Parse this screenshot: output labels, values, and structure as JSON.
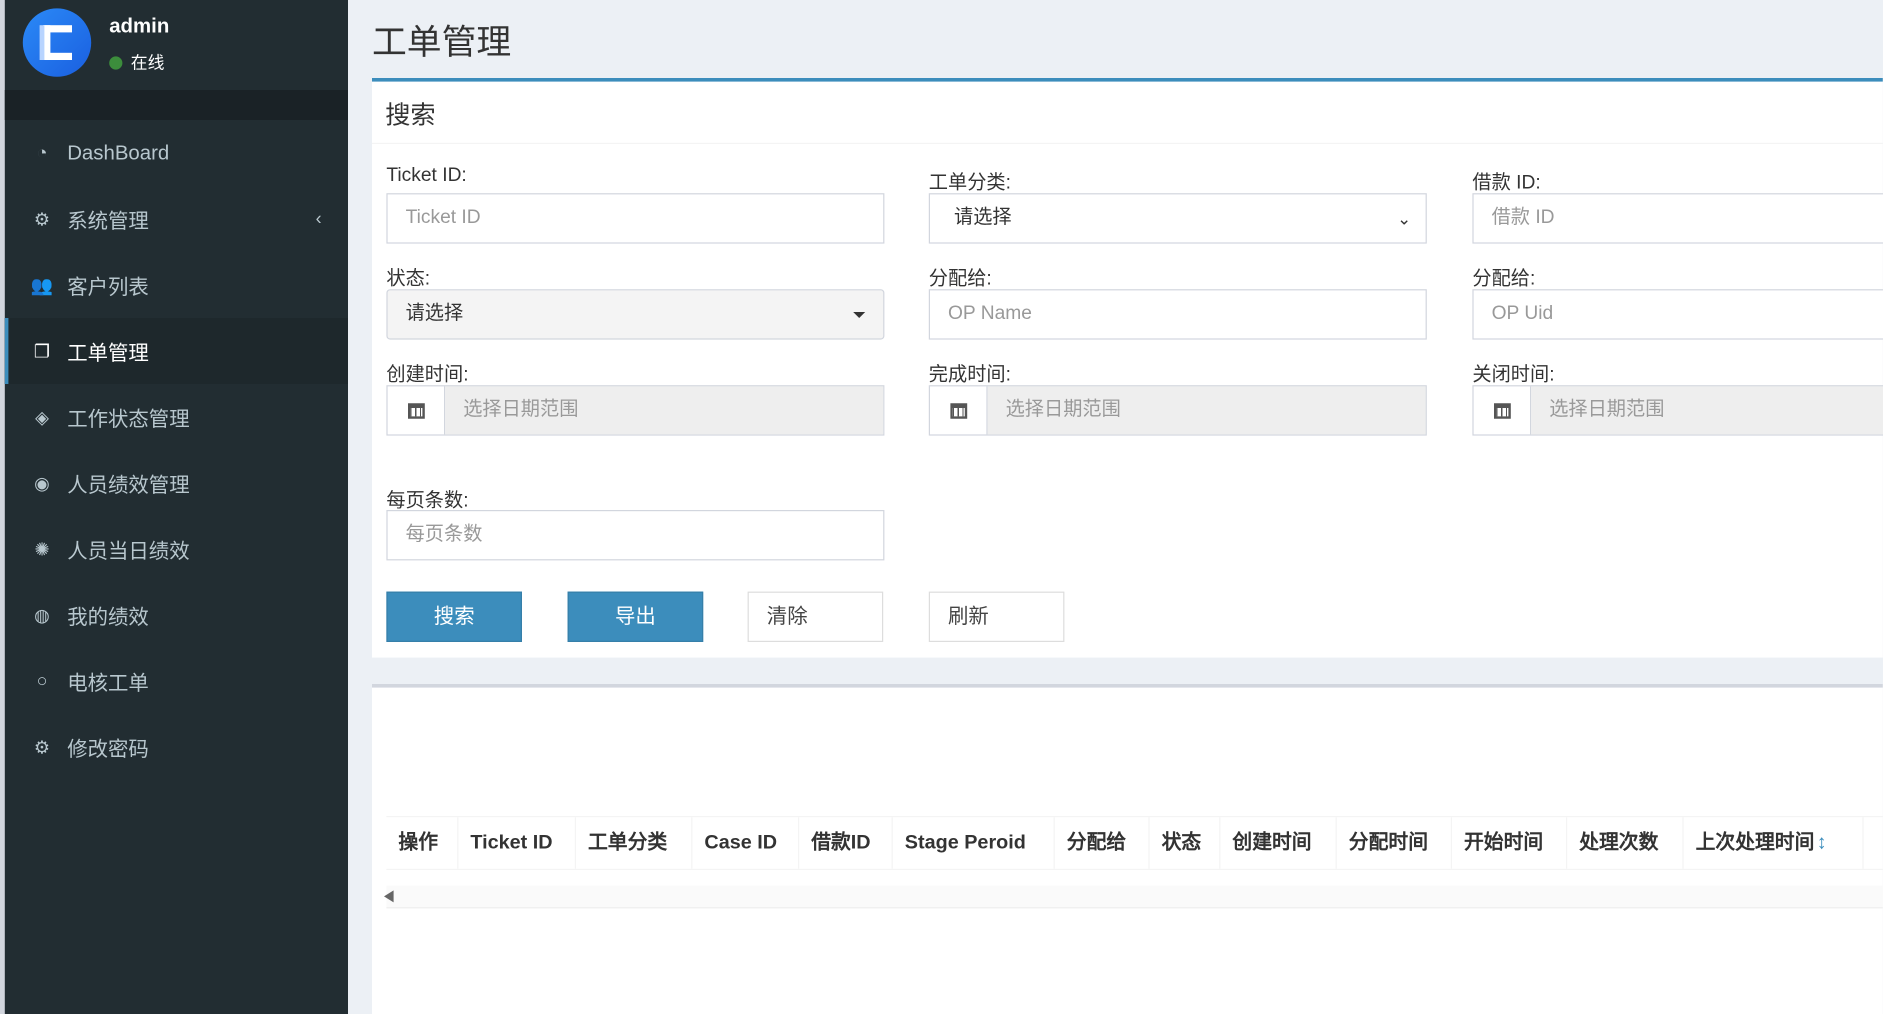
{
  "user": {
    "name": "admin",
    "status": "在线",
    "status_color": "#3c8d3c"
  },
  "sidebar": {
    "items": [
      {
        "label": "DashBoard",
        "icon": "dashboard-icon"
      },
      {
        "label": "系统管理",
        "icon": "cogs-icon",
        "has_submenu": true
      },
      {
        "label": "客户列表",
        "icon": "users-icon"
      },
      {
        "label": "工单管理",
        "icon": "copy-icon",
        "active": true
      },
      {
        "label": "工作状态管理",
        "icon": "tag-icon"
      },
      {
        "label": "人员绩效管理",
        "icon": "performance-icon"
      },
      {
        "label": "人员当日绩效",
        "icon": "daily-performance-icon"
      },
      {
        "label": "我的绩效",
        "icon": "chrome-icon"
      },
      {
        "label": "电核工单",
        "icon": "circle-icon"
      },
      {
        "label": "修改密码",
        "icon": "gear-icon"
      }
    ]
  },
  "page": {
    "title": "工单管理"
  },
  "search": {
    "title": "搜索",
    "ticket_id": {
      "label": "Ticket ID:",
      "placeholder": "Ticket ID"
    },
    "category": {
      "label": "工单分类:",
      "value": "请选择"
    },
    "loan_id": {
      "label": "借款 ID:",
      "placeholder": "借款 ID"
    },
    "status": {
      "label": "状态:",
      "value": "请选择"
    },
    "assign_name": {
      "label": "分配给:",
      "placeholder": "OP Name"
    },
    "assign_uid": {
      "label": "分配给:",
      "placeholder": "OP Uid"
    },
    "created": {
      "label": "创建时间:",
      "placeholder": "选择日期范围"
    },
    "completed": {
      "label": "完成时间:",
      "placeholder": "选择日期范围"
    },
    "closed": {
      "label": "关闭时间:",
      "placeholder": "选择日期范围"
    },
    "page_size": {
      "label": "每页条数:",
      "placeholder": "每页条数"
    },
    "buttons": {
      "search": "搜索",
      "export": "导出",
      "clear": "清除",
      "refresh": "刷新"
    }
  },
  "table": {
    "columns": [
      "操作",
      "Ticket ID",
      "工单分类",
      "Case ID",
      "借款ID",
      "Stage Peroid",
      "分配给",
      "状态",
      "创建时间",
      "分配时间",
      "开始时间",
      "处理次数",
      "上次处理时间"
    ]
  },
  "colors": {
    "accent": "#3c8dbc",
    "sidebar_bg": "#222d32"
  }
}
